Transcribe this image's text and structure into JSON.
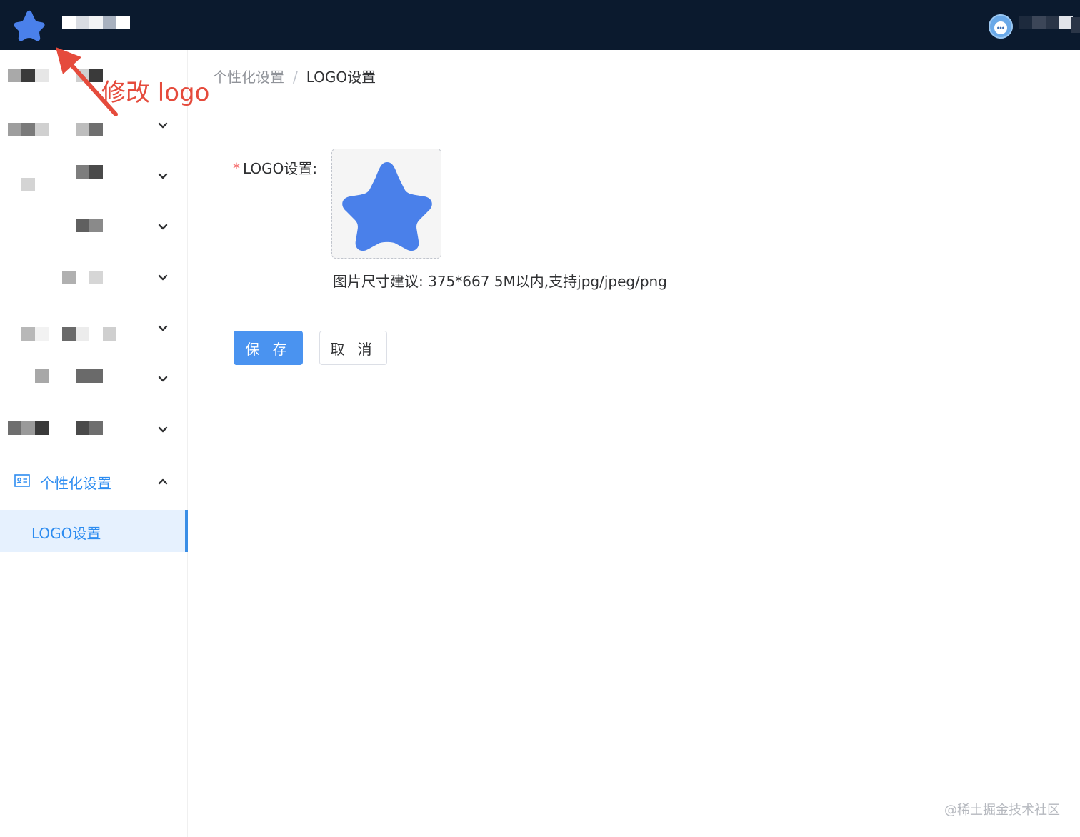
{
  "header": {
    "logo_icon": "star-icon",
    "brand_color": "#4a80ea",
    "background": "#0b1a2e",
    "avatar_icon": "avatar-icon"
  },
  "annotation": {
    "text": "修改 logo",
    "color": "#e54b3c"
  },
  "sidebar": {
    "collapsed_groups_count": 7,
    "active_group": {
      "icon": "id-card-icon",
      "label": "个性化设置",
      "expanded": true
    },
    "active_item": {
      "label": "LOGO设置"
    },
    "accent": "#2d8cf0"
  },
  "breadcrumb": {
    "parent": "个性化设置",
    "separator": "/",
    "current": "LOGO设置"
  },
  "form": {
    "required_mark": "*",
    "logo_label": "LOGO设置:",
    "upload_preview_icon": "star-icon",
    "hint": "图片尺寸建议: 375*667 5M以内,支持jpg/jpeg/png",
    "save_label": "保 存",
    "cancel_label": "取 消"
  },
  "watermark": "@稀土掘金技术社区"
}
